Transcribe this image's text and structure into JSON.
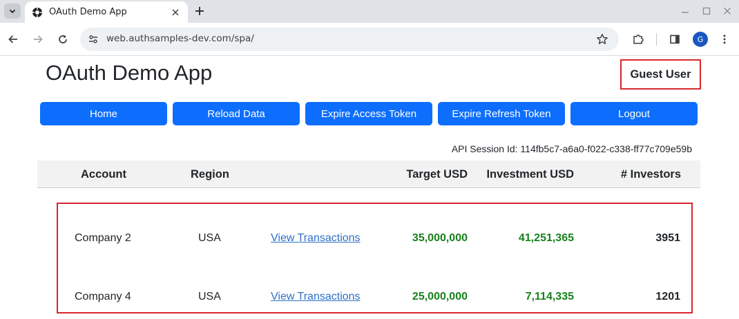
{
  "browser": {
    "tab_title": "OAuth Demo App",
    "url": "web.authsamples-dev.com/spa/",
    "profile_initial": "G"
  },
  "app": {
    "title": "OAuth Demo App",
    "user_label": "Guest User"
  },
  "nav": {
    "home": "Home",
    "reload": "Reload Data",
    "expire_access": "Expire Access Token",
    "expire_refresh": "Expire Refresh Token",
    "logout": "Logout"
  },
  "session": {
    "text": "API Session Id: 114fb5c7-a6a0-f022-c338-ff77c709e59b"
  },
  "table": {
    "headers": {
      "account": "Account",
      "region": "Region",
      "target": "Target USD",
      "investment": "Investment USD",
      "investors": "# Investors"
    },
    "rows": [
      {
        "account": "Company 2",
        "region": "USA",
        "link": "View Transactions",
        "target": "35,000,000",
        "investment": "41,251,365",
        "investors": "3951"
      },
      {
        "account": "Company 4",
        "region": "USA",
        "link": "View Transactions",
        "target": "25,000,000",
        "investment": "7,114,335",
        "investors": "1201"
      }
    ]
  },
  "colors": {
    "primary_button": "#0d6efd",
    "highlight_border": "#d7262a",
    "money_text": "#18801c",
    "link_text": "#2f6fc6"
  }
}
